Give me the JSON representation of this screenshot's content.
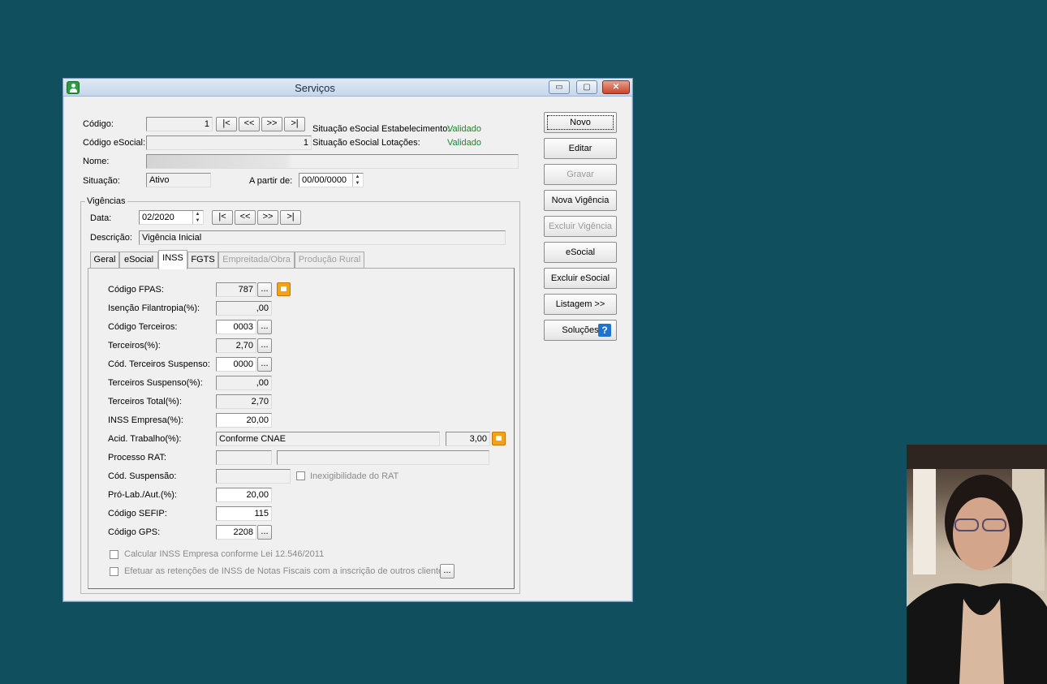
{
  "window": {
    "title": "Serviços",
    "buttons": {
      "minimize": "▭",
      "maximize": "▢",
      "close": "✕"
    }
  },
  "header": {
    "codigo_label": "Código:",
    "codigo_value": "1",
    "codigo_esocial_label": "Código eSocial:",
    "codigo_esocial_value": "1",
    "nome_label": "Nome:",
    "situacao_label": "Situação:",
    "situacao_value": "Ativo",
    "a_partir_label": "A partir de:",
    "a_partir_value": "00/00/0000",
    "nav": [
      "|<",
      "<<",
      ">>",
      ">|"
    ],
    "estab_label": "Situação eSocial Estabelecimento:",
    "estab_value": "Validado",
    "lotacoes_label": "Situação eSocial Lotações:",
    "lotacoes_value": "Validado"
  },
  "vigencias": {
    "group_label": "Vigências",
    "data_label": "Data:",
    "data_value": "02/2020",
    "descricao_label": "Descrição:",
    "descricao_value": "Vigência Inicial",
    "nav": [
      "|<",
      "<<",
      ">>",
      ">|"
    ]
  },
  "tabs": [
    "Geral",
    "eSocial",
    "INSS",
    "FGTS",
    "Empreitada/Obra",
    "Produção Rural"
  ],
  "inss": {
    "codigo_fpas_label": "Código FPAS:",
    "codigo_fpas_value": "787",
    "isencao_label": "Isenção Filantropia(%):",
    "isencao_value": ",00",
    "codigo_terceiros_label": "Código Terceiros:",
    "codigo_terceiros_value": "0003",
    "terceiros_label": "Terceiros(%):",
    "terceiros_value": "2,70",
    "cod_terceiros_suspenso_label": "Cód. Terceiros Suspenso:",
    "cod_terceiros_suspenso_value": "0000",
    "terceiros_suspenso_label": "Terceiros Suspenso(%):",
    "terceiros_suspenso_value": ",00",
    "terceiros_total_label": "Terceiros Total(%):",
    "terceiros_total_value": "2,70",
    "inss_empresa_label": "INSS Empresa(%):",
    "inss_empresa_value": "20,00",
    "acid_trabalho_label": "Acid. Trabalho(%):",
    "acid_trabalho_text": "Conforme CNAE",
    "acid_trabalho_value": "3,00",
    "processo_rat_label": "Processo RAT:",
    "cod_suspensao_label": "Cód. Suspensão:",
    "inexigibilidade_label": "Inexigibilidade do RAT",
    "pro_lab_label": "Pró-Lab./Aut.(%):",
    "pro_lab_value": "20,00",
    "codigo_sefip_label": "Código SEFIP:",
    "codigo_sefip_value": "115",
    "codigo_gps_label": "Código GPS:",
    "codigo_gps_value": "2208",
    "calcular_label": "Calcular INSS Empresa conforme Lei 12.546/2011",
    "efetuar_label": "Efetuar as retenções de INSS de Notas Fiscais com a inscrição de outros clientes",
    "ellipsis": "..."
  },
  "side_buttons": {
    "novo": "Novo",
    "editar": "Editar",
    "gravar": "Gravar",
    "nova_vigencia": "Nova Vigência",
    "excluir_vigencia": "Excluir Vigência",
    "esocial": "eSocial",
    "excluir_esocial": "Excluir eSocial",
    "listagem": "Listagem >>",
    "solucoes": "Soluções",
    "help_glyph": "?"
  },
  "colors": {
    "desktop": "#10505e",
    "validado": "#1b8a2a",
    "orange_icon": "#f3a117"
  }
}
